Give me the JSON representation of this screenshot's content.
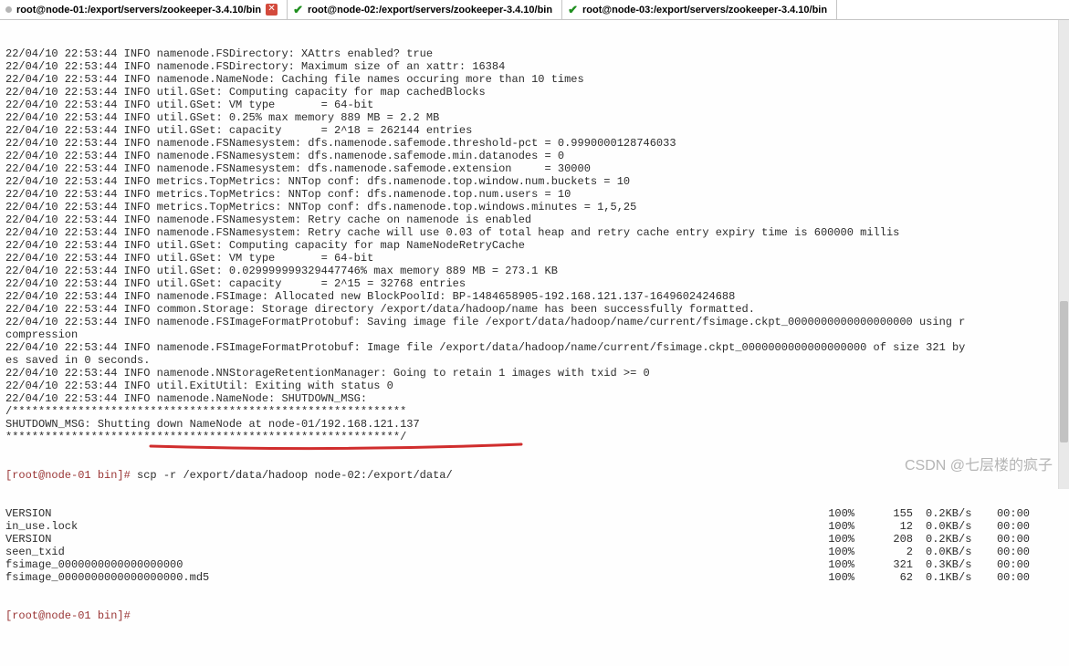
{
  "tabs": [
    {
      "dot_color": "#b5b5b5",
      "title": "root@node-01:/export/servers/zookeeper-3.4.10/bin",
      "has_close": true
    },
    {
      "dot_color": null,
      "title": "root@node-02:/export/servers/zookeeper-3.4.10/bin",
      "has_close": false,
      "has_check": true
    },
    {
      "dot_color": null,
      "title": "root@node-03:/export/servers/zookeeper-3.4.10/bin",
      "has_close": false,
      "has_check": true
    }
  ],
  "log_lines": [
    "22/04/10 22:53:44 INFO namenode.FSDirectory: XAttrs enabled? true",
    "22/04/10 22:53:44 INFO namenode.FSDirectory: Maximum size of an xattr: 16384",
    "22/04/10 22:53:44 INFO namenode.NameNode: Caching file names occuring more than 10 times",
    "22/04/10 22:53:44 INFO util.GSet: Computing capacity for map cachedBlocks",
    "22/04/10 22:53:44 INFO util.GSet: VM type       = 64-bit",
    "22/04/10 22:53:44 INFO util.GSet: 0.25% max memory 889 MB = 2.2 MB",
    "22/04/10 22:53:44 INFO util.GSet: capacity      = 2^18 = 262144 entries",
    "22/04/10 22:53:44 INFO namenode.FSNamesystem: dfs.namenode.safemode.threshold-pct = 0.9990000128746033",
    "22/04/10 22:53:44 INFO namenode.FSNamesystem: dfs.namenode.safemode.min.datanodes = 0",
    "22/04/10 22:53:44 INFO namenode.FSNamesystem: dfs.namenode.safemode.extension     = 30000",
    "22/04/10 22:53:44 INFO metrics.TopMetrics: NNTop conf: dfs.namenode.top.window.num.buckets = 10",
    "22/04/10 22:53:44 INFO metrics.TopMetrics: NNTop conf: dfs.namenode.top.num.users = 10",
    "22/04/10 22:53:44 INFO metrics.TopMetrics: NNTop conf: dfs.namenode.top.windows.minutes = 1,5,25",
    "22/04/10 22:53:44 INFO namenode.FSNamesystem: Retry cache on namenode is enabled",
    "22/04/10 22:53:44 INFO namenode.FSNamesystem: Retry cache will use 0.03 of total heap and retry cache entry expiry time is 600000 millis",
    "22/04/10 22:53:44 INFO util.GSet: Computing capacity for map NameNodeRetryCache",
    "22/04/10 22:53:44 INFO util.GSet: VM type       = 64-bit",
    "22/04/10 22:53:44 INFO util.GSet: 0.029999999329447746% max memory 889 MB = 273.1 KB",
    "22/04/10 22:53:44 INFO util.GSet: capacity      = 2^15 = 32768 entries",
    "22/04/10 22:53:44 INFO namenode.FSImage: Allocated new BlockPoolId: BP-1484658905-192.168.121.137-1649602424688",
    "22/04/10 22:53:44 INFO common.Storage: Storage directory /export/data/hadoop/name has been successfully formatted.",
    "22/04/10 22:53:44 INFO namenode.FSImageFormatProtobuf: Saving image file /export/data/hadoop/name/current/fsimage.ckpt_0000000000000000000 using r",
    "compression",
    "22/04/10 22:53:44 INFO namenode.FSImageFormatProtobuf: Image file /export/data/hadoop/name/current/fsimage.ckpt_0000000000000000000 of size 321 by",
    "es saved in 0 seconds.",
    "22/04/10 22:53:44 INFO namenode.NNStorageRetentionManager: Going to retain 1 images with txid >= 0",
    "22/04/10 22:53:44 INFO util.ExitUtil: Exiting with status 0",
    "22/04/10 22:53:44 INFO namenode.NameNode: SHUTDOWN_MSG:",
    "/************************************************************",
    "SHUTDOWN_MSG: Shutting down NameNode at node-01/192.168.121.137",
    "************************************************************/"
  ],
  "prompt1": "[root@node-01 bin]# ",
  "command1": "scp -r /export/data/hadoop node-02:/export/data/",
  "scp_rows": [
    {
      "name": "VERSION",
      "pct": "100%",
      "size": "155",
      "rate": "0.2KB/s",
      "time": "00:00"
    },
    {
      "name": "in_use.lock",
      "pct": "100%",
      "size": "12",
      "rate": "0.0KB/s",
      "time": "00:00"
    },
    {
      "name": "VERSION",
      "pct": "100%",
      "size": "208",
      "rate": "0.2KB/s",
      "time": "00:00"
    },
    {
      "name": "seen_txid",
      "pct": "100%",
      "size": "2",
      "rate": "0.0KB/s",
      "time": "00:00"
    },
    {
      "name": "fsimage_0000000000000000000",
      "pct": "100%",
      "size": "321",
      "rate": "0.3KB/s",
      "time": "00:00"
    },
    {
      "name": "fsimage_0000000000000000000.md5",
      "pct": "100%",
      "size": "62",
      "rate": "0.1KB/s",
      "time": "00:00"
    }
  ],
  "prompt2": "[root@node-01 bin]# ",
  "watermark": "CSDN @七层楼的疯子"
}
